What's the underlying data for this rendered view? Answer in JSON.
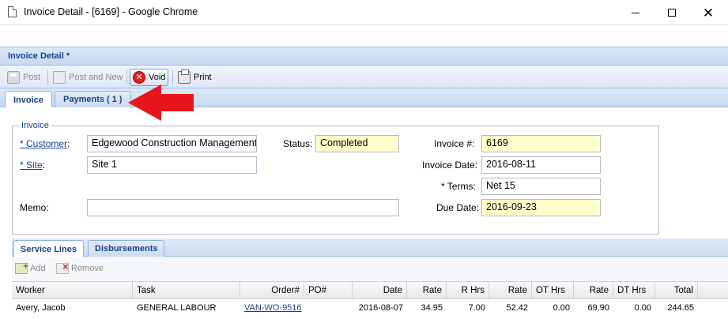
{
  "window": {
    "title": "Invoice Detail - [6169] - Google Chrome"
  },
  "panel": {
    "title": "Invoice Detail *"
  },
  "toolbar": {
    "post": "Post",
    "post_and_new": "Post and New",
    "void": "Void",
    "print": "Print"
  },
  "tabs": [
    {
      "label": "Invoice",
      "active": true
    },
    {
      "label": "Payments ( 1 )",
      "active": false
    }
  ],
  "invoice": {
    "legend": "Invoice",
    "customer_label": "Customer",
    "customer_value": "Edgewood Construction Management",
    "site_label": "Site",
    "site_value": "Site 1",
    "memo_label": "Memo:",
    "memo_value": "",
    "status_label": "Status:",
    "status_value": "Completed",
    "invoice_no_label": "Invoice #:",
    "invoice_no_value": "6169",
    "invoice_date_label": "Invoice Date:",
    "invoice_date_value": "2016-08-11",
    "terms_label": "* Terms:",
    "terms_value": "Net 15",
    "due_date_label": "Due Date:",
    "due_date_value": "2016-09-23"
  },
  "subtabs": [
    {
      "label": "Service Lines",
      "active": true
    },
    {
      "label": "Disbursements",
      "active": false
    }
  ],
  "subtoolbar": {
    "add": "Add",
    "remove": "Remove"
  },
  "grid": {
    "columns": [
      "Worker",
      "Task",
      "Order#",
      "PO#",
      "Date",
      "Rate",
      "R Hrs",
      "Rate",
      "OT Hrs",
      "Rate",
      "DT Hrs",
      "Total"
    ],
    "rows": [
      {
        "worker": "Avery, Jacob",
        "task": "GENERAL LABOUR",
        "order": "VAN-WO-9516",
        "po": "",
        "date": "2016-08-07",
        "rate": "34.95",
        "r_hrs": "7.00",
        "ot_rate": "52.42",
        "ot_hrs": "0.00",
        "dt_rate": "69.90",
        "dt_hrs": "0.00",
        "total": "244.65"
      }
    ]
  },
  "colors": {
    "header_text": "#15428b",
    "readonly_field": "#ffffcc",
    "annotation_arrow": "#e8141c"
  }
}
